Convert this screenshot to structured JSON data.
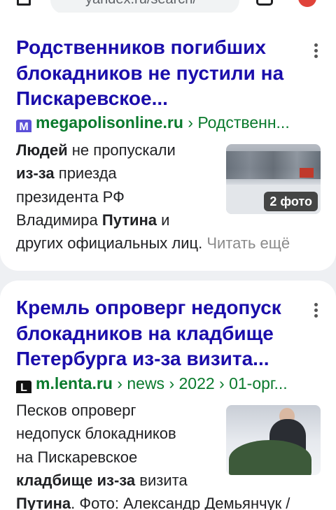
{
  "browser": {
    "url_text": "yandex.ru/search/"
  },
  "results": [
    {
      "title_parts": [
        "Родственников погибших",
        "блокадников ",
        "не пустили",
        " на",
        "Пискаревское..."
      ],
      "favicon_letter": "M",
      "domain": "megapolisonline.ru",
      "path": " › Родственн...",
      "snippet_lines": [
        [
          "Людей",
          " не пропускали"
        ],
        [
          "из-за",
          " приезда"
        ],
        [
          "президента РФ"
        ],
        [
          "Владимира ",
          "Путина",
          " и"
        ],
        [
          "других официальных лиц. ",
          "Читать ещё"
        ]
      ],
      "photo_badge": "2 фото"
    },
    {
      "title_parts": [
        "Кремль опроверг недопуск",
        "блокадников ",
        "на кладбище",
        "Петербурга ",
        "из-за",
        " визита..."
      ],
      "favicon_letter": "L",
      "domain": "m.lenta.ru",
      "path": " › news › 2022 › 01-орг...",
      "snippet_lines": [
        [
          "Песков опроверг"
        ],
        [
          "недопуск блокадников"
        ],
        [
          "на Пискаревское"
        ],
        [
          "кладбище из-за",
          " визита"
        ],
        [
          "Путина",
          ". Фото: Александр Демьянчук /"
        ]
      ]
    }
  ],
  "colors": {
    "title": "#1a0dab",
    "source": "#0a7a2d",
    "favicon_megapolis": "#5b4fd8",
    "favicon_lenta": "#111111"
  }
}
